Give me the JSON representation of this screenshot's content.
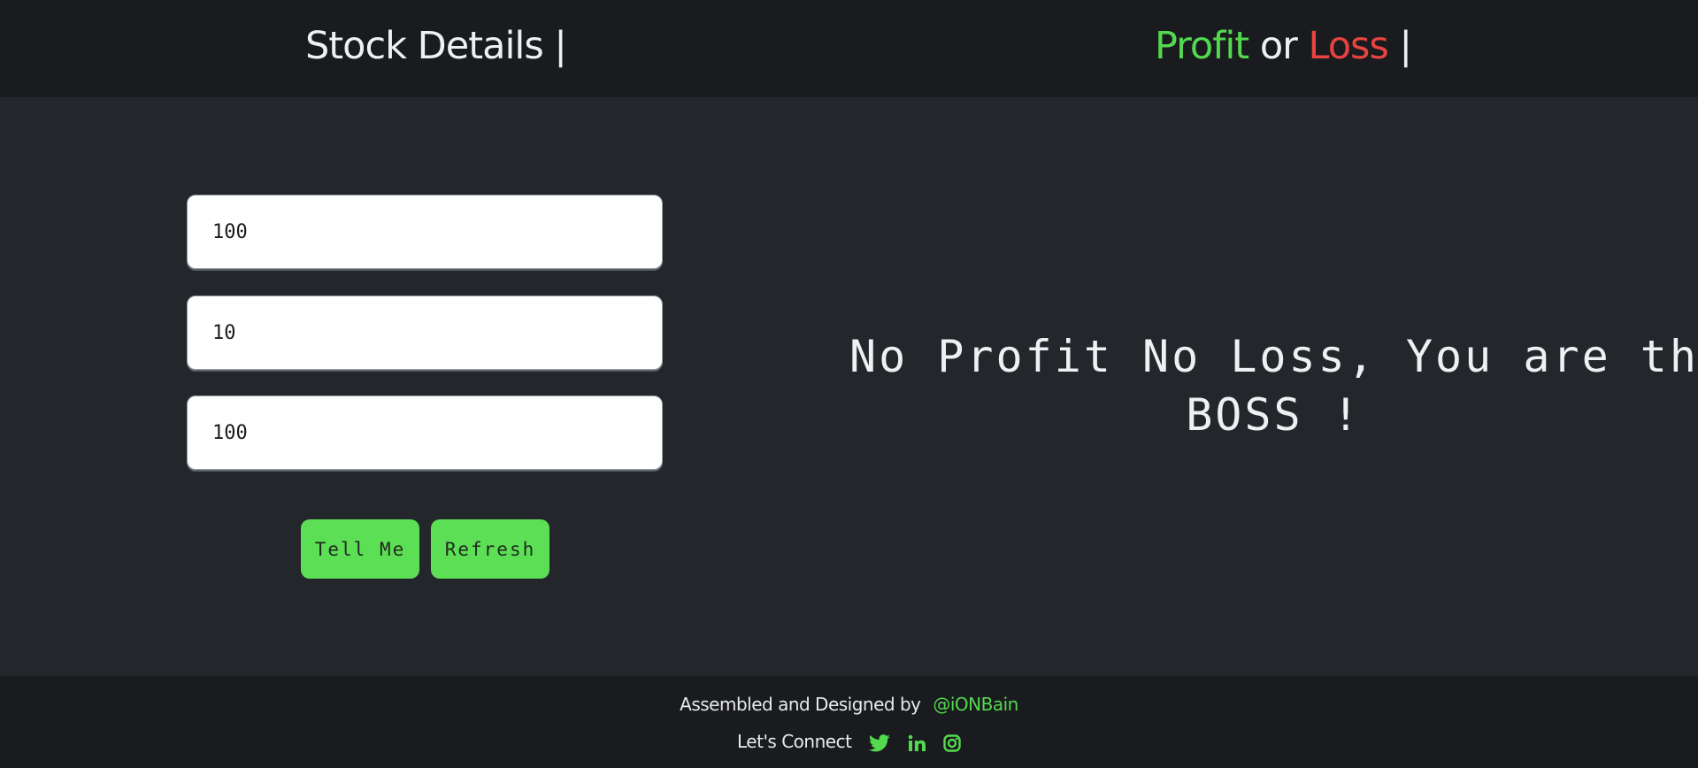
{
  "header": {
    "left_title": "Stock Details",
    "cursor": "|",
    "right_title": {
      "profit": "Profit",
      "or": "or",
      "loss": "Loss",
      "cursor": "|"
    }
  },
  "form": {
    "initial_price": "100",
    "quantity": "10",
    "current_price": "100",
    "tell_me_label": "Tell Me",
    "refresh_label": "Refresh"
  },
  "result": {
    "line1": "No Profit No Loss, You are the",
    "line2": "BOSS !"
  },
  "footer": {
    "credit": "Assembled and  Designed by",
    "handle": "@iONBain",
    "connect": "Let's Connect",
    "icons": [
      "twitter-icon",
      "linkedin-icon",
      "instagram-icon"
    ]
  },
  "colors": {
    "accent_green": "#52d94e",
    "button_green": "#5ddf55",
    "loss_red": "#e8443f",
    "header_bg": "#1a1b1f",
    "main_bg": "#23262b"
  }
}
